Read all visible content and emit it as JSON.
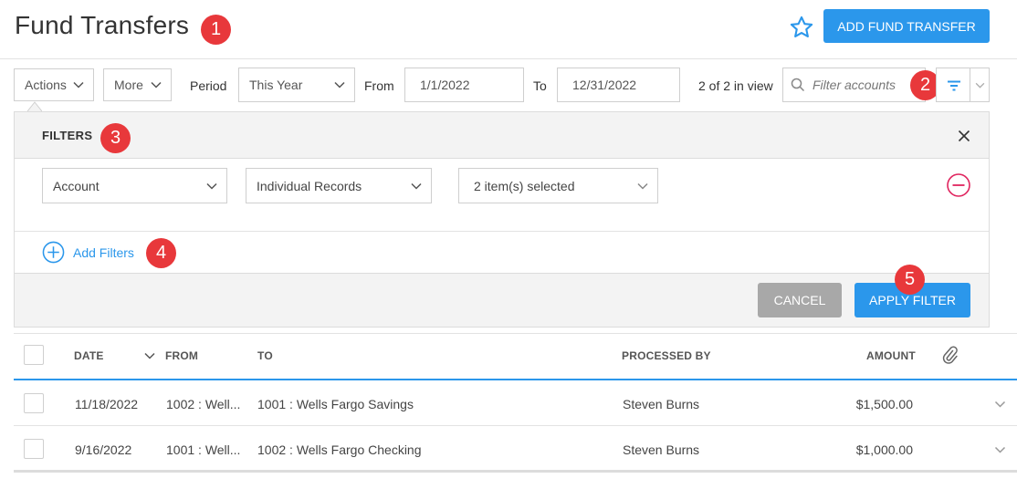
{
  "header": {
    "title": "Fund Transfers",
    "add_button": "ADD FUND TRANSFER",
    "badge1": "1"
  },
  "toolbar": {
    "actions_label": "Actions",
    "more_label": "More",
    "period_label": "Period",
    "period_value": "This Year",
    "from_label": "From",
    "from_value": "1/1/2022",
    "to_label": "To",
    "to_value": "12/31/2022",
    "view_count": "2 of 2 in view",
    "search_placeholder": "Filter accounts",
    "badge2": "2"
  },
  "filters": {
    "title": "FILTERS",
    "badge3": "3",
    "field": "Account",
    "mode": "Individual Records",
    "selection": "2 item(s) selected",
    "add_filters": "Add Filters",
    "badge4": "4",
    "cancel": "CANCEL",
    "apply": "APPLY FILTER",
    "badge5": "5"
  },
  "table": {
    "headers": {
      "date": "DATE",
      "from": "FROM",
      "to": "TO",
      "processed_by": "PROCESSED BY",
      "amount": "AMOUNT"
    },
    "rows": [
      {
        "date": "11/18/2022",
        "from": "1002 : Well...",
        "to": "1001 : Wells Fargo Savings",
        "processed_by": "Steven Burns",
        "amount": "$1,500.00"
      },
      {
        "date": "9/16/2022",
        "from": "1001 : Well...",
        "to": "1002 : Wells Fargo Checking",
        "processed_by": "Steven Burns",
        "amount": "$1,000.00"
      }
    ]
  },
  "colors": {
    "accent": "#2b97eb",
    "badge": "#e8383b",
    "remove": "#e0245e",
    "cancel": "#a8a8a8"
  },
  "icons": [
    "star-icon",
    "filter-icon",
    "search-icon",
    "chevron-down-icon",
    "close-icon",
    "remove-circle-icon",
    "add-circle-icon",
    "paperclip-icon"
  ]
}
